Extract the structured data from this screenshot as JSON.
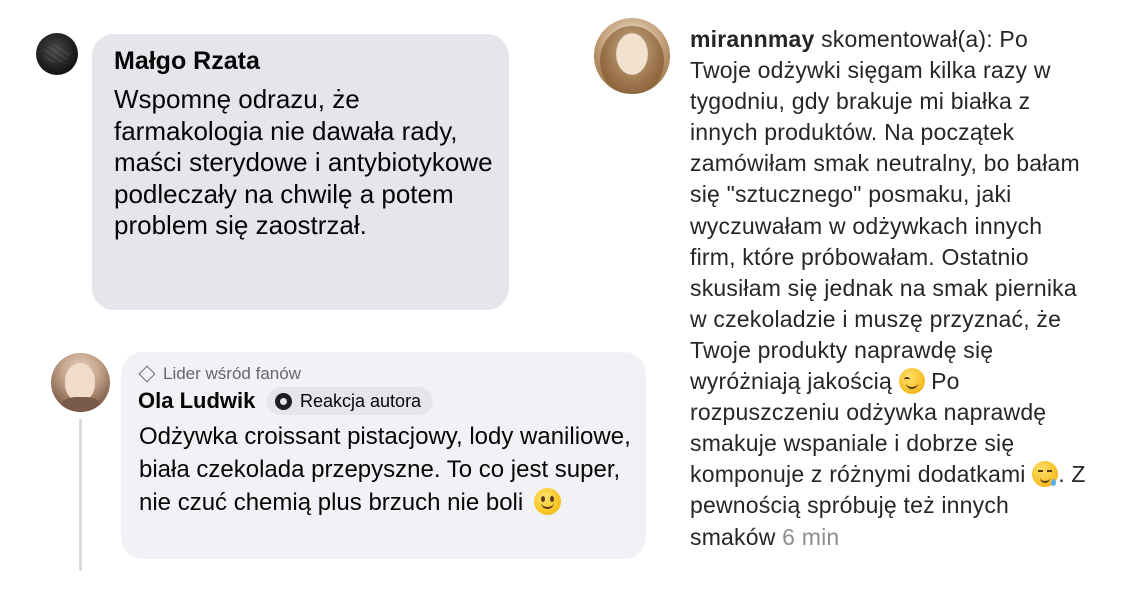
{
  "comment1": {
    "author": "Małgo Rzata",
    "text": "Wspomnę odrazu, że farmakologia nie dawała rady, maści sterydowe i antybiotykowe podleczały na chwilę a potem problem się zaostrzał."
  },
  "comment2": {
    "badge": "Lider wśród fanów",
    "author": "Ola Ludwik",
    "author_reaction_label": "Reakcja autora",
    "text": "Odżywka croissant pistacjowy, lody waniliowe, biała czekolada przepyszne. To co jest super, nie czuć chemią plus brzuch nie boli",
    "emoji": "slightly-smiling-face-icon"
  },
  "comment3": {
    "username": "mirannmay",
    "text_part1": "skomentował(a): Po Twoje odżywki sięgam kilka razy w tygodniu, gdy brakuje mi białka z innych produktów. Na początek zamówiłam smak neutralny, bo bałam się \"sztucznego\" posmaku, jaki wyczuwałam w odżywkach innych firm, które próbowałam. Ostatnio skusiłam się jednak na smak piernika w czekoladzie i muszę przyznać, że Twoje produkty naprawdę się wyróżniają jakością",
    "text_part2": "Po rozpuszczeniu odżywka naprawdę smakuje wspaniale i dobrze się komponuje z różnymi dodatkami",
    "text_part3": ". Z pewnością spróbuję też innych smaków",
    "time": "6 min"
  },
  "colors": {
    "bubble_gray": "#e4e6eb",
    "bubble_light": "#f0f2f5",
    "muted_text": "#65676b",
    "timestamp": "#8e8e8e"
  }
}
